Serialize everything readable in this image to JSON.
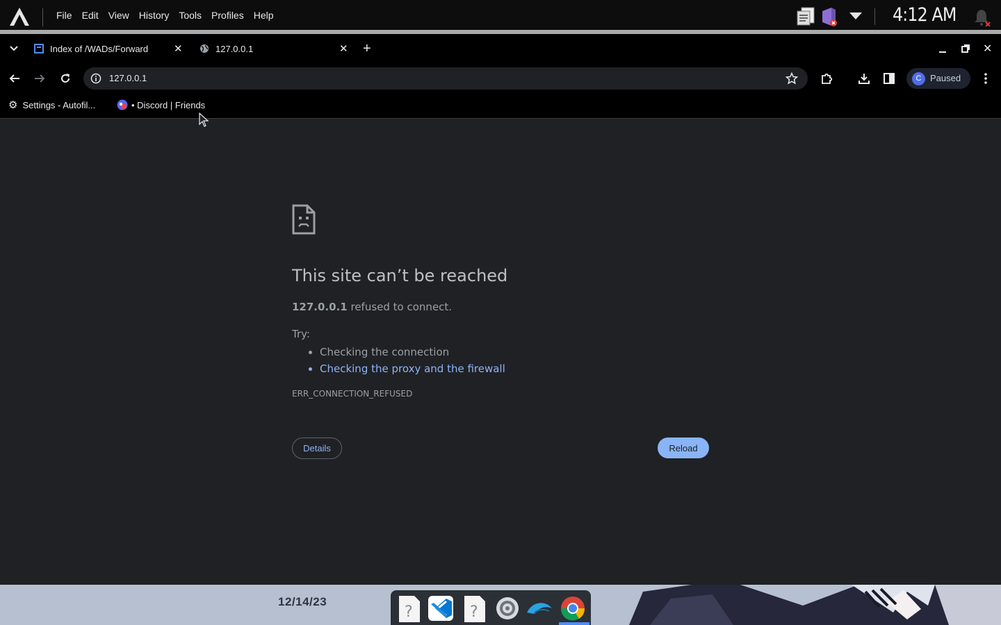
{
  "system_bar": {
    "menu": [
      "File",
      "Edit",
      "View",
      "History",
      "Tools",
      "Profiles",
      "Help"
    ],
    "clock": "4:12 AM",
    "tray_icons": [
      "clipboard-icon",
      "discord-icon",
      "dropdown-arrow-icon",
      "notification-bell-icon"
    ]
  },
  "tabs": [
    {
      "title": "Index of /WADs/Forward",
      "icon": "page-icon",
      "active": false
    },
    {
      "title": "127.0.0.1",
      "icon": "globe-icon",
      "active": true
    }
  ],
  "toolbar": {
    "url": "127.0.0.1",
    "profile_initial": "C",
    "profile_status": "Paused"
  },
  "bookmarks": [
    {
      "label": "Settings - Autofil...",
      "icon": "gear-icon"
    },
    {
      "label": "• Discord | Friends",
      "icon": "discord-icon"
    }
  ],
  "error_page": {
    "title": "This site can’t be reached",
    "host": "127.0.0.1",
    "message_suffix": " refused to connect.",
    "try_label": "Try:",
    "suggestions": [
      {
        "text": "Checking the connection",
        "link": false
      },
      {
        "text": "Checking the proxy and the firewall",
        "link": true
      }
    ],
    "error_code": "ERR_CONNECTION_REFUSED",
    "details_label": "Details",
    "reload_label": "Reload"
  },
  "desktop": {
    "date": "12/14/23",
    "dock_items": [
      "unknown-app-icon",
      "vscode-icon",
      "unknown-app-icon",
      "settings-icon",
      "dolphin-icon",
      "chrome-icon"
    ]
  },
  "colors": {
    "page_background": "#202124",
    "link": "#8ab4f8",
    "reload_button": "#8ab4f8",
    "desktop_background": "#b6c0d0"
  }
}
